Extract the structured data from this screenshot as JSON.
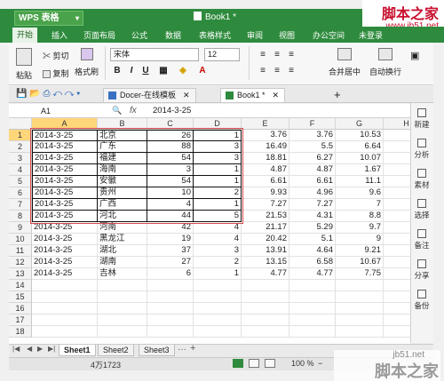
{
  "app": {
    "brand": "WPS 表格",
    "doc_title": "Book1 *"
  },
  "watermark": {
    "top_text": "脚本之家",
    "top_url": "www.jb51.net",
    "bottom_url": "jb51.net",
    "bottom_text": "脚本之家"
  },
  "menu": [
    "开始",
    "插入",
    "页面布局",
    "公式",
    "数据",
    "表格样式",
    "审阅",
    "视图",
    "办公空间",
    "未登录"
  ],
  "ribbon": {
    "cut": "剪切",
    "paste": "粘贴",
    "copy": "复制",
    "format_painter": "格式刷",
    "font": "宋体",
    "size": "12",
    "bold": "B",
    "italic": "I",
    "underline": "U",
    "merge": "合并居中",
    "wrap": "自动换行"
  },
  "tabs": [
    {
      "label": "Docer-在线模板"
    },
    {
      "label": "Book1 *"
    }
  ],
  "formula_bar": {
    "cell_ref": "A1",
    "fx": "fx",
    "value": "2014-3-25"
  },
  "columns": [
    "A",
    "B",
    "C",
    "D",
    "E",
    "F",
    "G",
    "H"
  ],
  "rows": [
    {
      "n": "1",
      "a": "2014-3-25",
      "b": "北京",
      "c": "26",
      "d": "1",
      "e": "3.76",
      "f": "3.76",
      "g": "10.53"
    },
    {
      "n": "2",
      "a": "2014-3-25",
      "b": "广东",
      "c": "88",
      "d": "3",
      "e": "16.49",
      "f": "5.5",
      "g": "6.64"
    },
    {
      "n": "3",
      "a": "2014-3-25",
      "b": "福建",
      "c": "54",
      "d": "3",
      "e": "18.81",
      "f": "6.27",
      "g": "10.07"
    },
    {
      "n": "4",
      "a": "2014-3-25",
      "b": "海南",
      "c": "3",
      "d": "1",
      "e": "4.87",
      "f": "4.87",
      "g": "1.67"
    },
    {
      "n": "5",
      "a": "2014-3-25",
      "b": "安徽",
      "c": "54",
      "d": "1",
      "e": "6.61",
      "f": "6.61",
      "g": "11.1"
    },
    {
      "n": "6",
      "a": "2014-3-25",
      "b": "贵州",
      "c": "10",
      "d": "2",
      "e": "9.93",
      "f": "4.96",
      "g": "9.6"
    },
    {
      "n": "7",
      "a": "2014-3-25",
      "b": "广西",
      "c": "4",
      "d": "1",
      "e": "7.27",
      "f": "7.27",
      "g": "7"
    },
    {
      "n": "8",
      "a": "2014-3-25",
      "b": "河北",
      "c": "44",
      "d": "5",
      "e": "21.53",
      "f": "4.31",
      "g": "8.8"
    },
    {
      "n": "9",
      "a": "2014-3-25",
      "b": "河南",
      "c": "42",
      "d": "4",
      "e": "21.17",
      "f": "5.29",
      "g": "9.7"
    },
    {
      "n": "10",
      "a": "2014-3-25",
      "b": "黑龙江",
      "c": "19",
      "d": "4",
      "e": "20.42",
      "f": "5.1",
      "g": "9"
    },
    {
      "n": "11",
      "a": "2014-3-25",
      "b": "湖北",
      "c": "37",
      "d": "3",
      "e": "13.91",
      "f": "4.64",
      "g": "9.21"
    },
    {
      "n": "12",
      "a": "2014-3-25",
      "b": "湖南",
      "c": "27",
      "d": "2",
      "e": "13.15",
      "f": "6.58",
      "g": "10.67"
    },
    {
      "n": "13",
      "a": "2014-3-25",
      "b": "吉林",
      "c": "6",
      "d": "1",
      "e": "4.77",
      "f": "4.77",
      "g": "7.75"
    },
    {
      "n": "14"
    },
    {
      "n": "15"
    },
    {
      "n": "16"
    },
    {
      "n": "17"
    },
    {
      "n": "18"
    }
  ],
  "side_panel": [
    "新建",
    "分析",
    "素材",
    "选择",
    "备注",
    "分享",
    "备份"
  ],
  "sheets": [
    "Sheet1",
    "Sheet2",
    "Sheet3"
  ],
  "status": {
    "count": "4万1723",
    "zoom": "100 %"
  }
}
